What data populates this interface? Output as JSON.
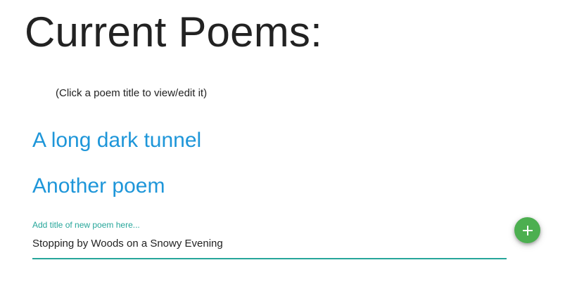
{
  "header": {
    "title": "Current Poems:"
  },
  "instructions": "(Click a poem title to view/edit it)",
  "poems": [
    {
      "title": "A long dark tunnel"
    },
    {
      "title": "Another poem"
    }
  ],
  "new_poem": {
    "label": "Add title of new poem here...",
    "value": "Stopping by Woods on a Snowy Evening",
    "add_icon": "plus-icon"
  },
  "colors": {
    "link": "#1e96d9",
    "accent": "#26a69a",
    "fab": "#4caf50"
  }
}
